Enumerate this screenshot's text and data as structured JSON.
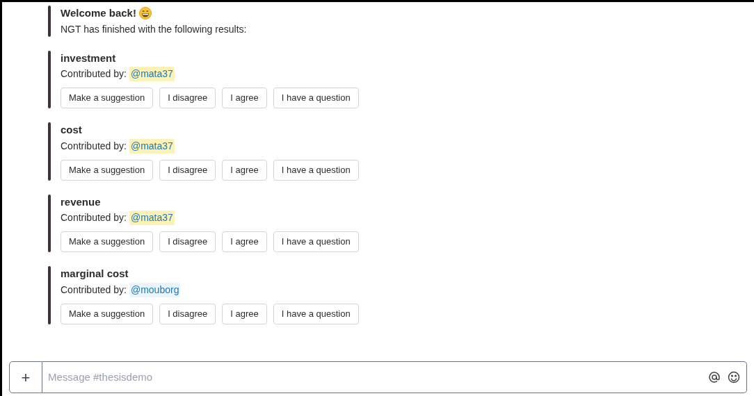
{
  "intro": {
    "title": "Welcome back!",
    "text": "NGT has finished with the following results:"
  },
  "results": [
    {
      "title": "investment",
      "label": "Contributed by:",
      "mention": "@mata37",
      "highlighted": true,
      "buttons": [
        "Make a suggestion",
        "I disagree",
        "I agree",
        "I have a question"
      ]
    },
    {
      "title": "cost",
      "label": "Contributed by:",
      "mention": "@mata37",
      "highlighted": true,
      "buttons": [
        "Make a suggestion",
        "I disagree",
        "I agree",
        "I have a question"
      ]
    },
    {
      "title": "revenue",
      "label": "Contributed by:",
      "mention": "@mata37",
      "highlighted": true,
      "buttons": [
        "Make a suggestion",
        "I disagree",
        "I agree",
        "I have a question"
      ]
    },
    {
      "title": "marginal cost",
      "label": "Contributed by:",
      "mention": "@mouborg",
      "highlighted": false,
      "buttons": [
        "Make a suggestion",
        "I disagree",
        "I agree",
        "I have a question"
      ]
    }
  ],
  "composer": {
    "plus": "+",
    "placeholder": "Message #thesisdemo"
  }
}
